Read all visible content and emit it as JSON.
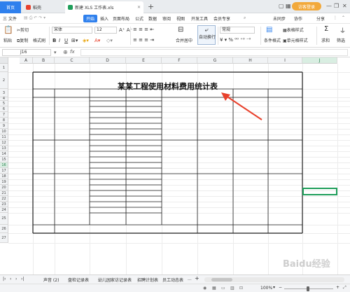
{
  "window": {
    "tabs": [
      {
        "label": "首页"
      },
      {
        "label": "稻壳"
      },
      {
        "label": "新建 XLS 工作表.xls"
      }
    ],
    "login_label": "访客登录"
  },
  "menu": {
    "items": [
      "三 文件",
      "开始",
      "插入",
      "页面布局",
      "公式",
      "数据",
      "审阅",
      "视图",
      "开发工具",
      "会员专享"
    ],
    "right_items": [
      "未同步",
      "协作",
      "分享"
    ]
  },
  "ribbon": {
    "cut": "剪切",
    "paste": "粘贴",
    "copy": "复制",
    "format_painter": "格式刷",
    "font_name": "宋体",
    "font_size": "12",
    "merge_center": "合并居中",
    "wrap_text": "自动换行",
    "number_format": "常规",
    "conditional_format": "条件格式",
    "table_style": "表格样式",
    "cell_style": "单元格样式",
    "sum": "求和",
    "filter": "筛选"
  },
  "formula_bar": {
    "name_box": "J16",
    "fx": "fx"
  },
  "sheet": {
    "columns": [
      "A",
      "B",
      "C",
      "D",
      "E",
      "F",
      "G",
      "H",
      "I",
      "J"
    ],
    "rows": [
      "1",
      "2",
      "3",
      "4",
      "5",
      "6",
      "7",
      "8",
      "9",
      "10",
      "11",
      "12",
      "13",
      "14",
      "15",
      "16",
      "17",
      "18",
      "19",
      "20",
      "21",
      "22",
      "23",
      "24",
      "25",
      "26",
      "27"
    ],
    "title": "某某工程使用材料费用统计表"
  },
  "sheet_tabs": {
    "items": [
      "声音 (2)",
      "盘检记录表",
      "幼儿园家访记录表",
      "招聘计划表",
      "员工动态表"
    ],
    "more": "...",
    "add": "+"
  },
  "status": {
    "zoom": "100%",
    "zoom_minus": "−",
    "zoom_plus": "+"
  },
  "colors": {
    "accent": "#2f80ed",
    "selection": "#1e9e5a",
    "arrow": "#e8412c",
    "login": "#f2a93b"
  },
  "watermark": "Baidu经验"
}
